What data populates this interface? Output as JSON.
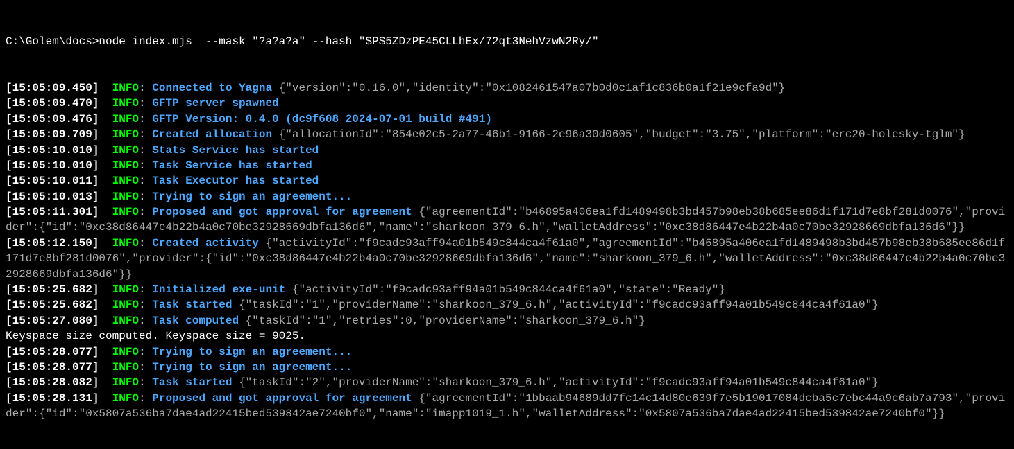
{
  "prompt": "C:\\Golem\\docs>node index.mjs  --mask \"?a?a?a\" --hash \"$P$5ZDzPE45CLLhEx/72qt3NehVzwN2Ry/\"",
  "lines": [
    {
      "ts": "[15:05:09.450]",
      "level": "INFO",
      "msg": "Connected to Yagna",
      "json": "{\"version\":\"0.16.0\",\"identity\":\"0x1082461547a07b0d0c1af1c836b0a1f21e9cfa9d\"}"
    },
    {
      "ts": "[15:05:09.470]",
      "level": "INFO",
      "msg": "GFTP server spawned",
      "json": ""
    },
    {
      "ts": "[15:05:09.476]",
      "level": "INFO",
      "msg": "GFTP Version: 0.4.0 (dc9f608 2024-07-01 build #491)",
      "json": ""
    },
    {
      "ts": "[15:05:09.709]",
      "level": "INFO",
      "msg": "Created allocation",
      "json": "{\"allocationId\":\"854e02c5-2a77-46b1-9166-2e96a30d0605\",\"budget\":\"3.75\",\"platform\":\"erc20-holesky-tglm\"}"
    },
    {
      "ts": "[15:05:10.010]",
      "level": "INFO",
      "msg": "Stats Service has started",
      "json": ""
    },
    {
      "ts": "[15:05:10.010]",
      "level": "INFO",
      "msg": "Task Service has started",
      "json": ""
    },
    {
      "ts": "[15:05:10.011]",
      "level": "INFO",
      "msg": "Task Executor has started",
      "json": ""
    },
    {
      "ts": "[15:05:10.013]",
      "level": "INFO",
      "msg": "Trying to sign an agreement...",
      "json": ""
    },
    {
      "ts": "[15:05:11.301]",
      "level": "INFO",
      "msg": "Proposed and got approval for agreement",
      "json": "{\"agreementId\":\"b46895a406ea1fd1489498b3bd457b98eb38b685ee86d1f171d7e8bf281d0076\",\"provider\":{\"id\":\"0xc38d86447e4b22b4a0c70be32928669dbfa136d6\",\"name\":\"sharkoon_379_6.h\",\"walletAddress\":\"0xc38d86447e4b22b4a0c70be32928669dbfa136d6\"}}"
    },
    {
      "ts": "[15:05:12.150]",
      "level": "INFO",
      "msg": "Created activity",
      "json": "{\"activityId\":\"f9cadc93aff94a01b549c844ca4f61a0\",\"agreementId\":\"b46895a406ea1fd1489498b3bd457b98eb38b685ee86d1f171d7e8bf281d0076\",\"provider\":{\"id\":\"0xc38d86447e4b22b4a0c70be32928669dbfa136d6\",\"name\":\"sharkoon_379_6.h\",\"walletAddress\":\"0xc38d86447e4b22b4a0c70be32928669dbfa136d6\"}}"
    },
    {
      "ts": "[15:05:25.682]",
      "level": "INFO",
      "msg": "Initialized exe-unit",
      "json": "{\"activityId\":\"f9cadc93aff94a01b549c844ca4f61a0\",\"state\":\"Ready\"}"
    },
    {
      "ts": "[15:05:25.682]",
      "level": "INFO",
      "msg": "Task started",
      "json": "{\"taskId\":\"1\",\"providerName\":\"sharkoon_379_6.h\",\"activityId\":\"f9cadc93aff94a01b549c844ca4f61a0\"}"
    },
    {
      "ts": "[15:05:27.080]",
      "level": "INFO",
      "msg": "Task computed",
      "json": "{\"taskId\":\"1\",\"retries\":0,\"providerName\":\"sharkoon_379_6.h\"}"
    },
    {
      "plain": "Keyspace size computed. Keyspace size = 9025."
    },
    {
      "ts": "[15:05:28.077]",
      "level": "INFO",
      "msg": "Trying to sign an agreement...",
      "json": ""
    },
    {
      "ts": "[15:05:28.077]",
      "level": "INFO",
      "msg": "Trying to sign an agreement...",
      "json": ""
    },
    {
      "ts": "[15:05:28.082]",
      "level": "INFO",
      "msg": "Task started",
      "json": "{\"taskId\":\"2\",\"providerName\":\"sharkoon_379_6.h\",\"activityId\":\"f9cadc93aff94a01b549c844ca4f61a0\"}"
    },
    {
      "ts": "[15:05:28.131]",
      "level": "INFO",
      "msg": "Proposed and got approval for agreement",
      "json": "{\"agreementId\":\"1bbaab94689dd7fc14c14d80e639f7e5b19017084dcba5c7ebc44a9c6ab7a793\",\"provider\":{\"id\":\"0x5807a536ba7dae4ad22415bed539842ae7240bf0\",\"name\":\"imapp1019_1.h\",\"walletAddress\":\"0x5807a536ba7dae4ad22415bed539842ae7240bf0\"}}"
    }
  ]
}
